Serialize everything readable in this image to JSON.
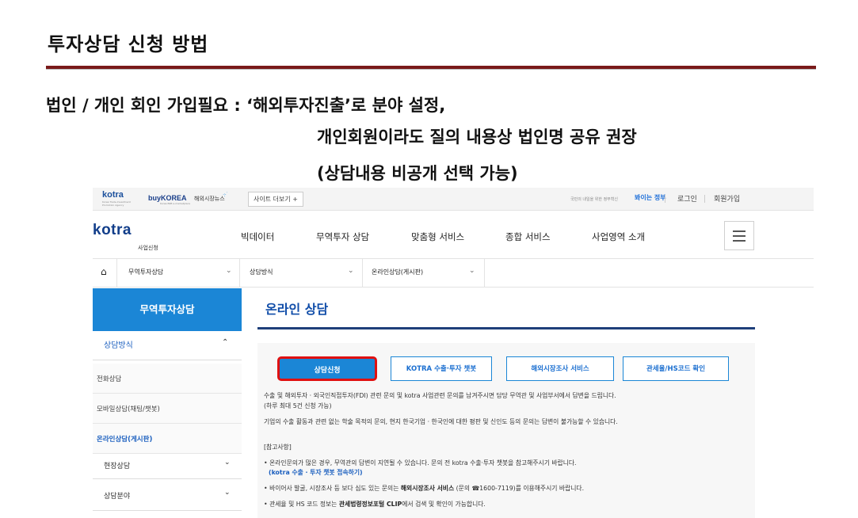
{
  "slide": {
    "title": "투자상담 신청 방법",
    "line1": "법인 / 개인 회인 가입필요 :  ‘해외투자진출’로 분야 설정,",
    "line2": "개인회원이라도 질의 내용상 법인명 공유 권장",
    "line3": "(상담내용 비공개 선택 가능)"
  },
  "topbar": {
    "kotra_logo": "kotra",
    "kotra_sub": "Korea Trade-Investment Promotion Agency",
    "buykorea_logo": "buyKOREA",
    "buykorea_sub": "Korea B2B e-marketplace",
    "market_news": "해외시장뉴스",
    "site_more": "사이트 더보기 +",
    "slogan": "국민의 내일을 위한 정부혁신",
    "slogan_logo": "봐이는 정부",
    "login": "로그인",
    "join": "회원가입"
  },
  "header": {
    "logo": "kotra",
    "logo_sub": "사업신청",
    "nav": [
      "빅데이터",
      "무역투자 상담",
      "맞춤형 서비스",
      "종합 서비스",
      "사업영역 소개"
    ]
  },
  "breadcrumb": {
    "items": [
      "무역투자상담",
      "상담방식",
      "온라인상담(게시판)"
    ]
  },
  "sidebar": {
    "header": "무역투자상담",
    "section": "상담방식",
    "items": [
      "전화상담",
      "모바일상담(채팅/챗봇)",
      "온라인상담(게시판)"
    ],
    "extra": [
      "현장상담",
      "상담분야"
    ]
  },
  "content": {
    "title": "온라인 상담",
    "buttons": [
      "상담신청",
      "KOTRA 수출·투자 챗봇",
      "해외시장조사 서비스",
      "관세율/HS코드 확인"
    ],
    "desc1": "수출 및 해외투자 · 외국인직접투자(FDI) 관련 문의 및 kotra 사업관련 문의를 남겨주시면 담당 무역관 및 사업부서에서 답변을 드립니다.",
    "desc2": "(하루 최대 5건 신청 가능)",
    "desc3": "기업의 수출 활동과 관련 없는 학술 목적의 문의, 현지 한국기업 · 한국인에 대한 평판 및 신인도 등의 문의는 답변이 불가능할 수 있습니다.",
    "ref_title": "[참고사항]",
    "note1": "• 온라인문의가 많은 경우, 무역관의 답변이 지연될 수 있습니다. 문의 전 kotra 수출·투자 챗봇을 참고해주시기 바랍니다.",
    "note1_link": "(kotra 수출 · 투자 챗봇 접속하기)",
    "note2_a": "• 바이어사 발굴, 시장조사 등 보다 심도 있는 문의는 ",
    "note2_b": "해외시장조사 서비스",
    "note2_c": " (문의 ☎1600-7119)를 이용해주시기 바랍니다.",
    "note3_a": "• 관세율 및 HS 코드 정보는 ",
    "note3_b": "관세법령정보포털 CLIP",
    "note3_c": "에서 검색 및 확인이 가능합니다."
  },
  "colors": {
    "accent": "#1b86d6",
    "highlight": "#e01010",
    "rule": "#7a1a1a"
  }
}
